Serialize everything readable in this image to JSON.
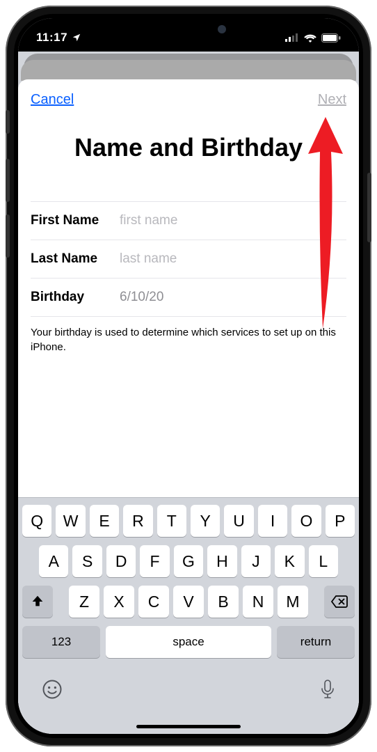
{
  "status": {
    "time": "11:17",
    "signal_bars": 2,
    "wifi": true,
    "battery": 100
  },
  "nav": {
    "cancel": "Cancel",
    "next": "Next"
  },
  "title": "Name and Birthday",
  "fields": {
    "first_name": {
      "label": "First Name",
      "placeholder": "first name",
      "value": ""
    },
    "last_name": {
      "label": "Last Name",
      "placeholder": "last name",
      "value": ""
    },
    "birthday": {
      "label": "Birthday",
      "value": "6/10/20"
    }
  },
  "footnote": "Your birthday is used to determine which services to set up on this iPhone.",
  "keyboard": {
    "row1": [
      "Q",
      "W",
      "E",
      "R",
      "T",
      "Y",
      "U",
      "I",
      "O",
      "P"
    ],
    "row2": [
      "A",
      "S",
      "D",
      "F",
      "G",
      "H",
      "J",
      "K",
      "L"
    ],
    "row3": [
      "Z",
      "X",
      "C",
      "V",
      "B",
      "N",
      "M"
    ],
    "numbers": "123",
    "space": "space",
    "return": "return"
  },
  "icons": {
    "location": "location-arrow-icon",
    "shift": "shift-icon",
    "delete": "delete-icon",
    "emoji": "emoji-icon",
    "mic": "mic-icon"
  },
  "annotation": {
    "color": "#ed1c24"
  }
}
